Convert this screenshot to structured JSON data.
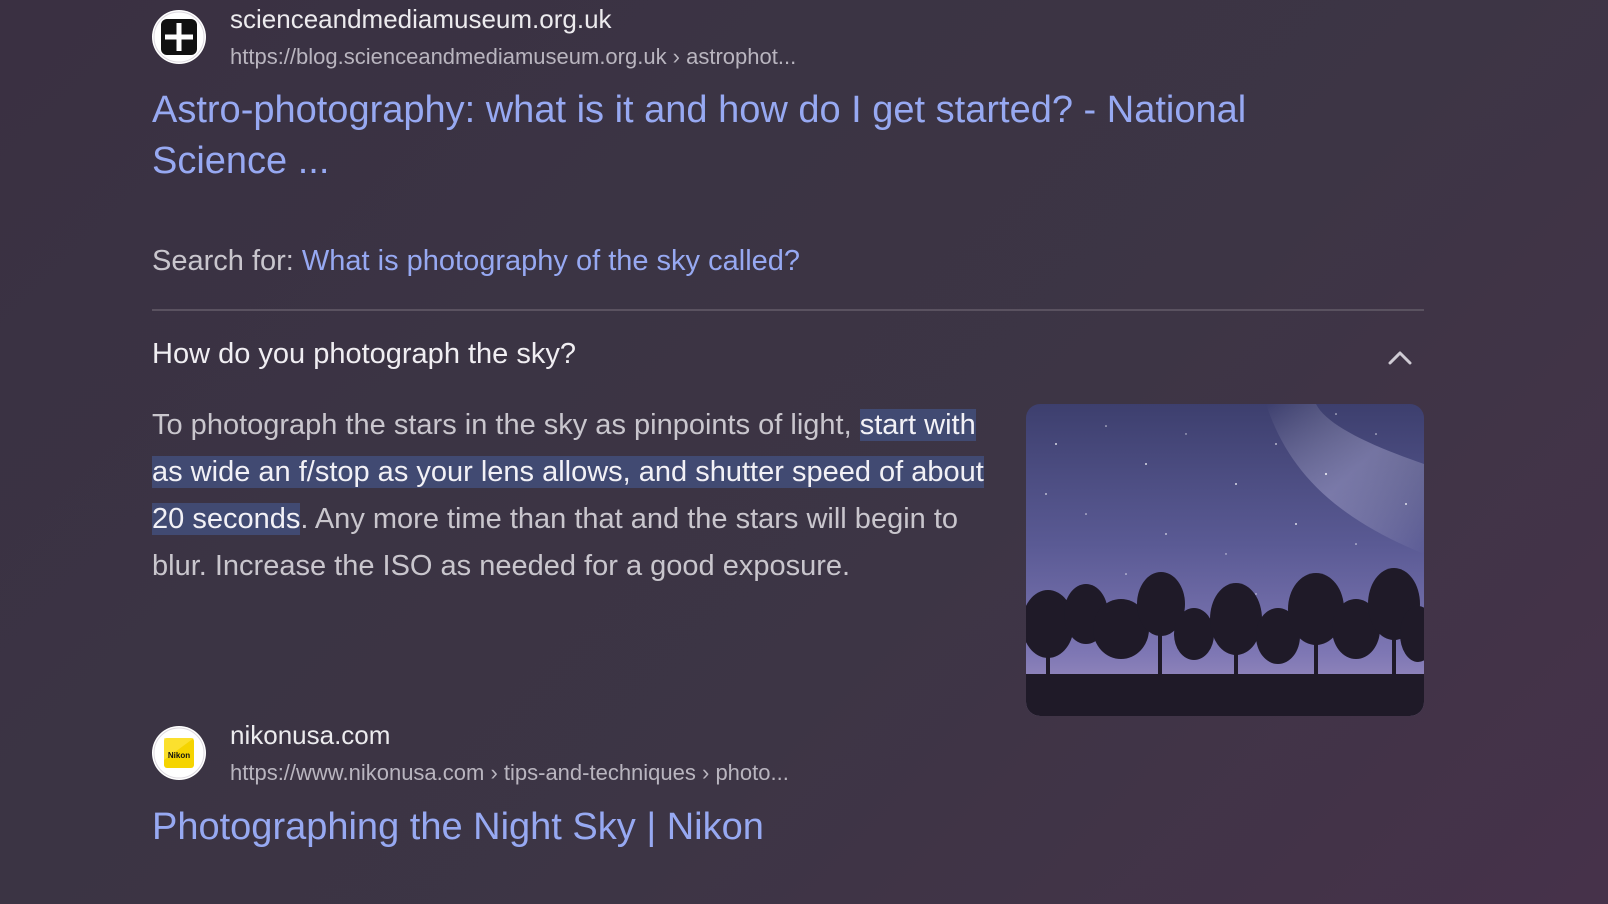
{
  "result1": {
    "site_name": "scienceandmediamuseum.org.uk",
    "url": "https://blog.scienceandmediamuseum.org.uk › astrophot...",
    "title_line1": "Astro-photography: what is it and how do I get started? - National",
    "title_line2": "Science ...",
    "favicon": "plus-square-icon"
  },
  "search_for": {
    "label": "Search for: ",
    "query": "What is photography of the sky called?"
  },
  "paa": {
    "question": "How do you photograph the sky?",
    "toggle_icon": "chevron-up-icon",
    "answer": {
      "before": "To photograph the stars in the sky as pinpoints of light, ",
      "highlight": "start with as wide an f/stop as your lens allows, and shutter speed of about 20 seconds",
      "after": ". Any more time than that and the stars will begin to blur. Increase the ISO as needed for a good exposure."
    },
    "image": "night-sky-trees-image"
  },
  "result2": {
    "site_name": "nikonusa.com",
    "url": "https://www.nikonusa.com › tips-and-techniques › photo...",
    "title": "Photographing the Night Sky | Nikon",
    "favicon": "nikon-logo-icon",
    "favicon_text": "Nikon"
  },
  "colors": {
    "link": "#97a9f2",
    "highlight_bg": "#414a72",
    "background": "#3b3444"
  }
}
